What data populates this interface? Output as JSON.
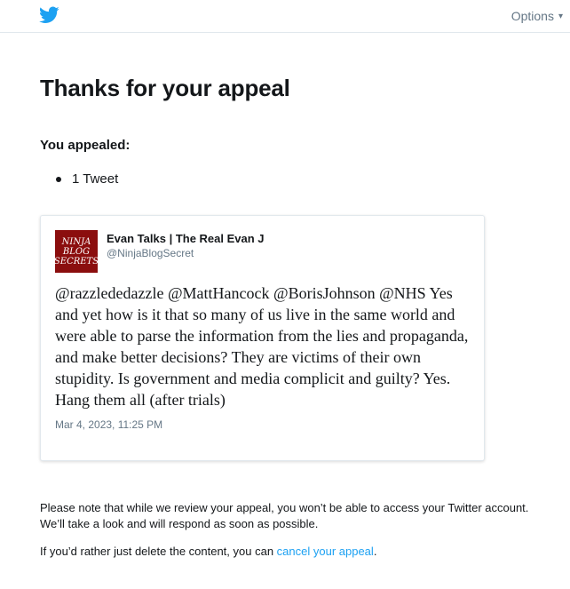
{
  "header": {
    "options_label": "Options",
    "brand_color": "#1da1f2"
  },
  "page": {
    "title": "Thanks for your appeal",
    "appealed_label": "You appealed:",
    "appealed_items": [
      "1 Tweet"
    ]
  },
  "tweet": {
    "author_name": "Evan Talks | The Real Evan J",
    "author_handle": "@NinjaBlogSecret",
    "avatar_text": [
      "NINJA",
      "BLOG",
      "SECRETS"
    ],
    "text": "@razzlededazzle @MattHancock @BorisJohnson @NHS Yes and yet how is it that so many of us live in the same world and were able to parse the information from the lies and propaganda, and make better decisions? They are victims of their own stupidity. Is government and media complicit and guilty? Yes. Hang them all (after trials)",
    "timestamp": "Mar 4, 2023, 11:25 PM"
  },
  "footer": {
    "review_note": "Please note that while we review your appeal, you won’t be able to access your Twitter account. We’ll take a look and will respond as soon as possible.",
    "delete_prefix": "If you’d rather just delete the content, you can ",
    "cancel_link": "cancel your appeal",
    "delete_suffix": "."
  }
}
